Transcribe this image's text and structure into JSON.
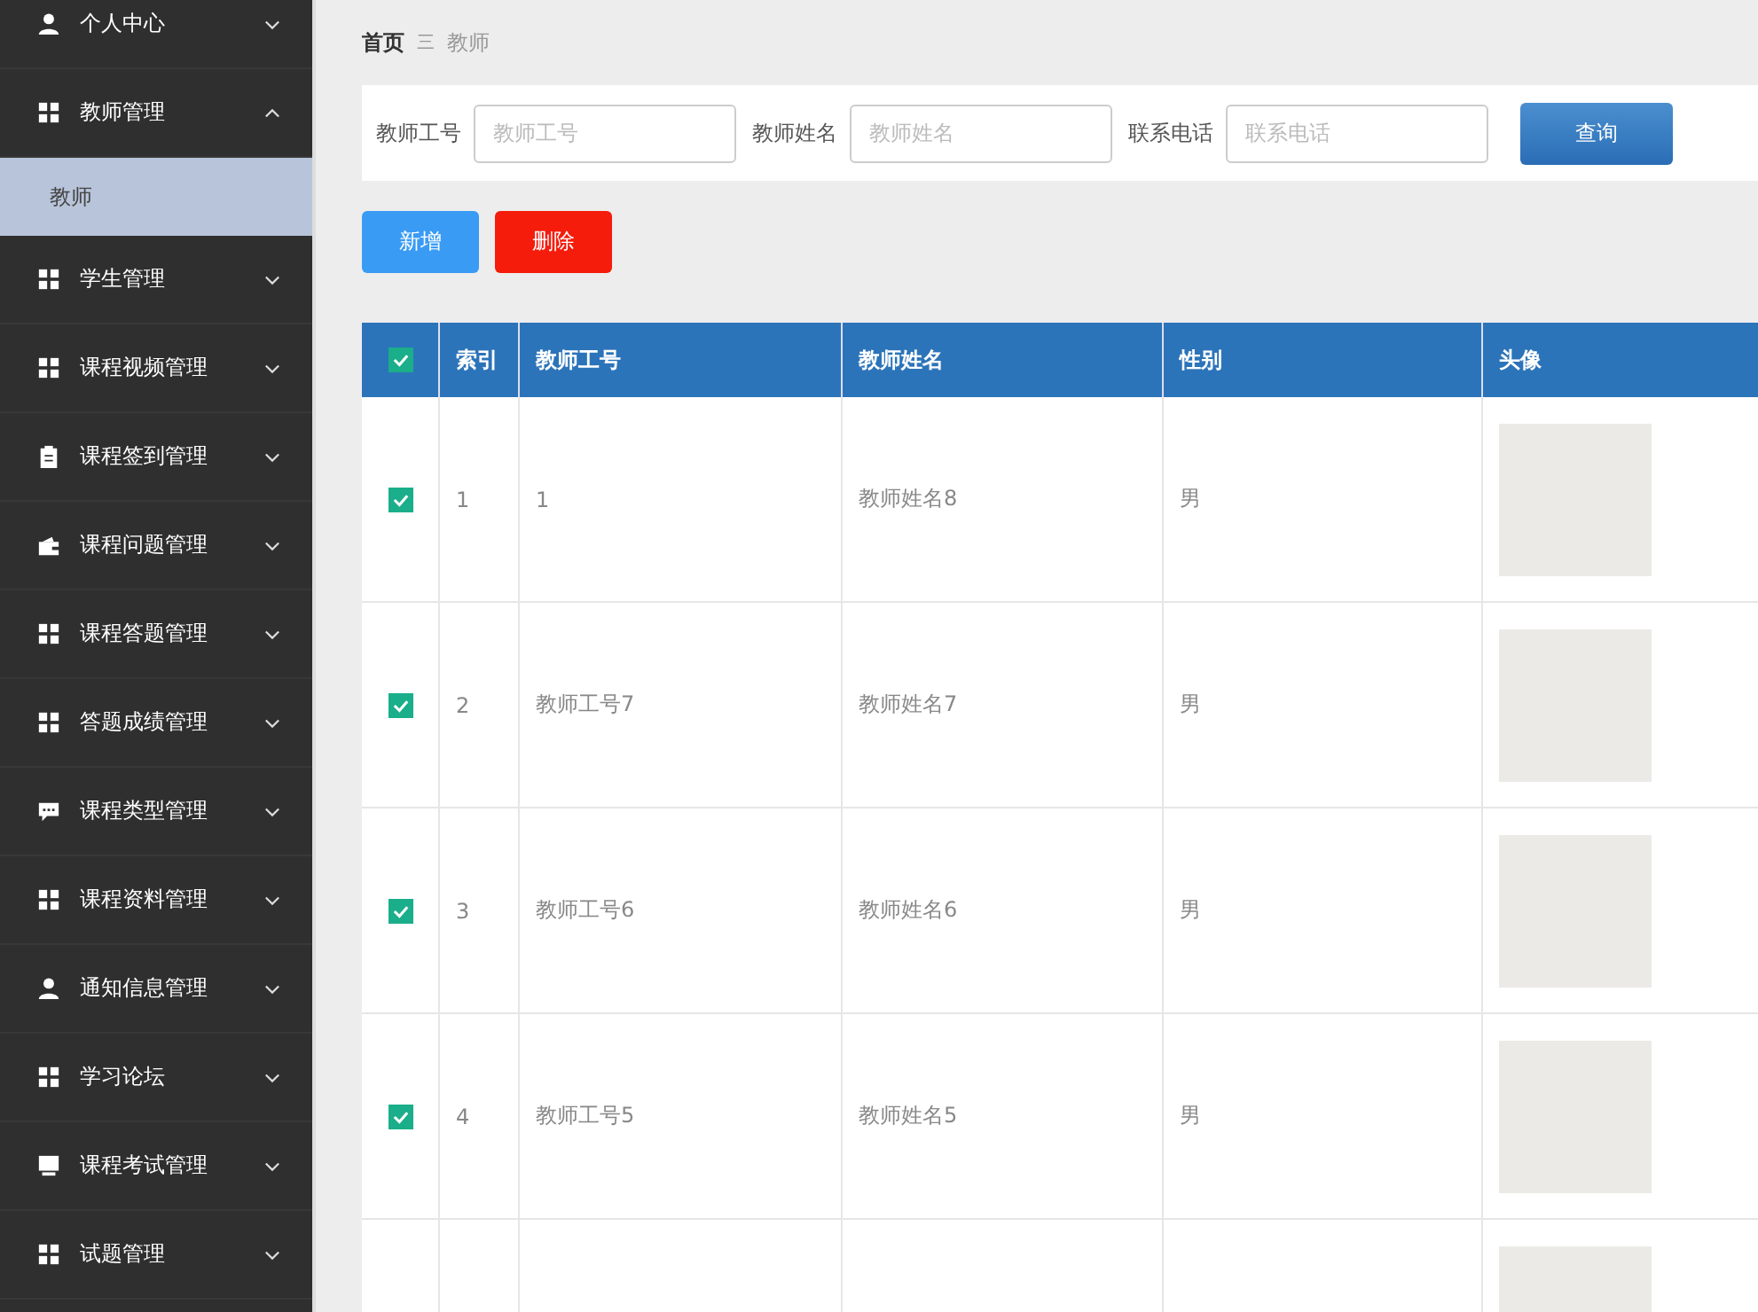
{
  "sidebar": {
    "items": [
      {
        "label": "个人中心",
        "expanded": false
      },
      {
        "label": "教师管理",
        "expanded": true,
        "children": [
          {
            "label": "教师",
            "selected": true
          }
        ]
      },
      {
        "label": "学生管理",
        "expanded": false
      },
      {
        "label": "课程视频管理",
        "expanded": false
      },
      {
        "label": "课程签到管理",
        "expanded": false
      },
      {
        "label": "课程问题管理",
        "expanded": false
      },
      {
        "label": "课程答题管理",
        "expanded": false
      },
      {
        "label": "答题成绩管理",
        "expanded": false
      },
      {
        "label": "课程类型管理",
        "expanded": false
      },
      {
        "label": "课程资料管理",
        "expanded": false
      },
      {
        "label": "通知信息管理",
        "expanded": false
      },
      {
        "label": "学习论坛",
        "expanded": false
      },
      {
        "label": "课程考试管理",
        "expanded": false
      },
      {
        "label": "试题管理",
        "expanded": false
      }
    ]
  },
  "breadcrumb": {
    "items": [
      "首页",
      "教师"
    ],
    "separator": "三"
  },
  "search": {
    "fields": [
      {
        "label": "教师工号",
        "placeholder": "教师工号"
      },
      {
        "label": "教师姓名",
        "placeholder": "教师姓名"
      },
      {
        "label": "联系电话",
        "placeholder": "联系电话"
      }
    ],
    "button": "查询"
  },
  "actions": {
    "add": "新增",
    "delete": "删除"
  },
  "table": {
    "all_checked": true,
    "columns": [
      "索引",
      "教师工号",
      "教师姓名",
      "性别",
      "头像"
    ],
    "rows": [
      {
        "checked": true,
        "cells": [
          "1",
          "1",
          "教师姓名8",
          "男"
        ]
      },
      {
        "checked": true,
        "cells": [
          "2",
          "教师工号7",
          "教师姓名7",
          "男"
        ]
      },
      {
        "checked": true,
        "cells": [
          "3",
          "教师工号6",
          "教师姓名6",
          "男"
        ]
      },
      {
        "checked": true,
        "cells": [
          "4",
          "教师工号5",
          "教师姓名5",
          "男"
        ]
      },
      {
        "cells": []
      }
    ]
  }
}
